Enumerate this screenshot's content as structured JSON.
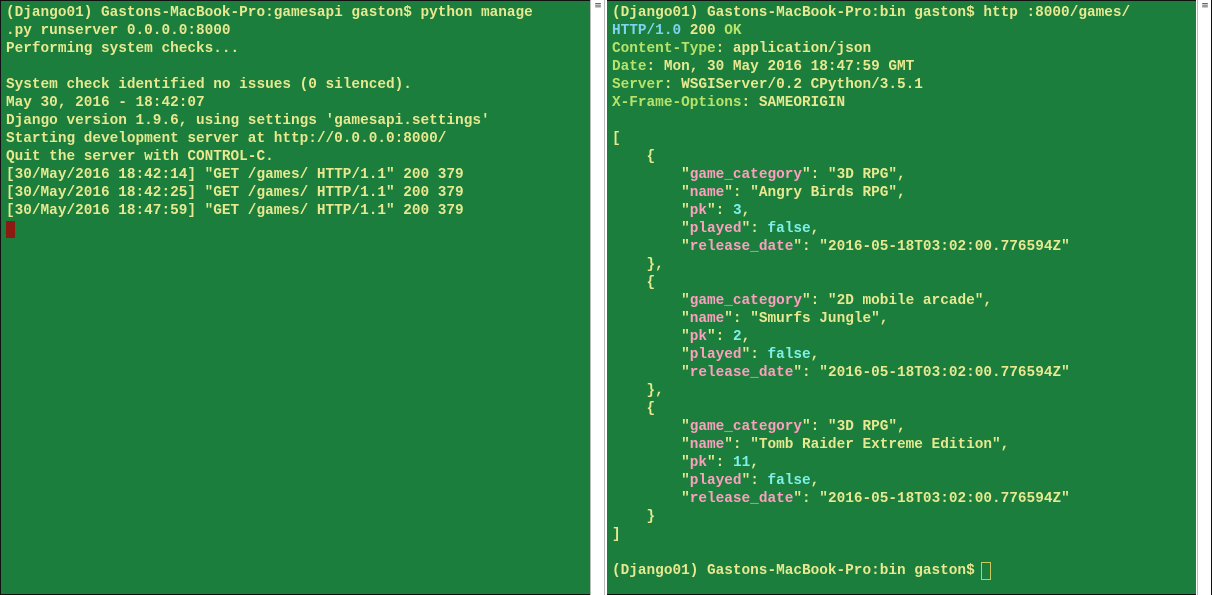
{
  "left_terminal": {
    "lines": [
      "(Django01) Gastons-MacBook-Pro:gamesapi gaston$ python manage",
      ".py runserver 0.0.0.0:8000",
      "Performing system checks...",
      "",
      "System check identified no issues (0 silenced).",
      "May 30, 2016 - 18:42:07",
      "Django version 1.9.6, using settings 'gamesapi.settings'",
      "Starting development server at http://0.0.0.0:8000/",
      "Quit the server with CONTROL-C.",
      "[30/May/2016 18:42:14] \"GET /games/ HTTP/1.1\" 200 379",
      "[30/May/2016 18:42:25] \"GET /games/ HTTP/1.1\" 200 379",
      "[30/May/2016 18:47:59] \"GET /games/ HTTP/1.1\" 200 379"
    ]
  },
  "right_terminal": {
    "command": "(Django01) Gastons-MacBook-Pro:bin gaston$ http :8000/games/",
    "status": {
      "protocol": "HTTP",
      "version": "/1.0",
      "code": "200",
      "reason": "OK"
    },
    "headers": [
      {
        "name": "Content-Type",
        "value": "application/json"
      },
      {
        "name": "Date",
        "value": "Mon, 30 May 2016 18:47:59 GMT"
      },
      {
        "name": "Server",
        "value": "WSGIServer/0.2 CPython/3.5.1"
      },
      {
        "name": "X-Frame-Options",
        "value": "SAMEORIGIN"
      }
    ],
    "games": [
      {
        "game_category": "3D RPG",
        "name": "Angry Birds RPG",
        "pk": "3",
        "played": "false",
        "release_date": "2016-05-18T03:02:00.776594Z"
      },
      {
        "game_category": "2D mobile arcade",
        "name": "Smurfs Jungle",
        "pk": "2",
        "played": "false",
        "release_date": "2016-05-18T03:02:00.776594Z"
      },
      {
        "game_category": "3D RPG",
        "name": "Tomb Raider Extreme Edition",
        "pk": "11",
        "played": "false",
        "release_date": "2016-05-18T03:02:00.776594Z"
      }
    ],
    "prompt": "(Django01) Gastons-MacBook-Pro:bin gaston$"
  },
  "colors": {
    "terminal_bg": "#1b7e3c",
    "text": "#e8e890",
    "json_key": "#ff9fc0",
    "json_literal": "#7ff0e8",
    "header_name": "#b7e36a",
    "protocol": "#7fd3f0",
    "cursor_left": "#8b1a10"
  }
}
